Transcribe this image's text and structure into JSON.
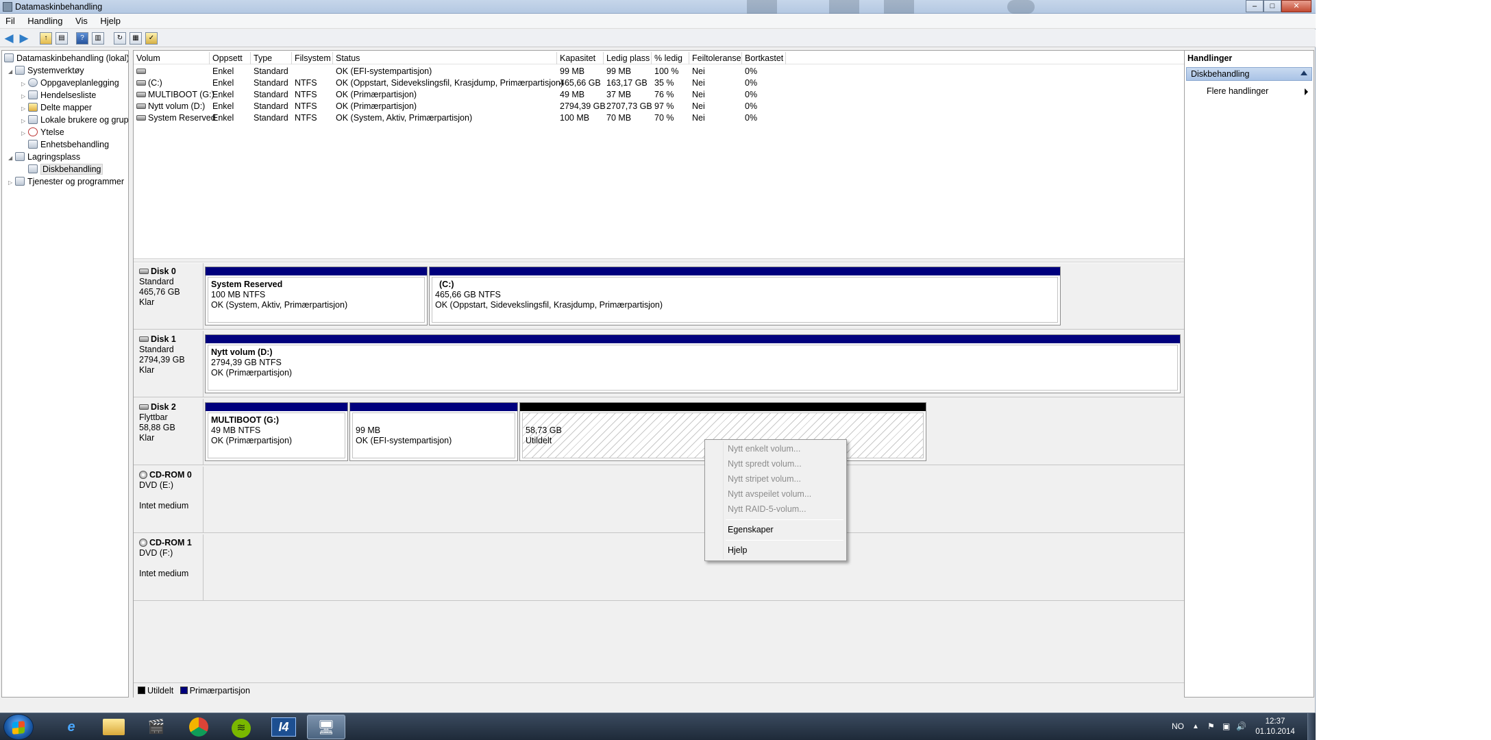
{
  "window": {
    "title": "Datamaskinbehandling",
    "min": "–",
    "max": "□",
    "close": "✕"
  },
  "menu": [
    "Fil",
    "Handling",
    "Vis",
    "Hjelp"
  ],
  "tree": {
    "root": "Datamaskinbehandling (lokal)",
    "systemverktoy": "Systemverktøy",
    "oppgave": "Oppgaveplanlegging",
    "hendelse": "Hendelsesliste",
    "delte": "Delte mapper",
    "lokale": "Lokale brukere og grupp",
    "ytelse": "Ytelse",
    "enhet": "Enhetsbehandling",
    "lagring": "Lagringsplass",
    "disk": "Diskbehandling",
    "tjenester": "Tjenester og programmer"
  },
  "volumes": {
    "columns": [
      "Volum",
      "Oppsett",
      "Type",
      "Filsystem",
      "Status",
      "Kapasitet",
      "Ledig plass",
      "% ledig",
      "Feiltoleranse",
      "Bortkastet"
    ],
    "rows": [
      {
        "volum": "",
        "oppsett": "Enkel",
        "type": "Standard",
        "fs": "",
        "status": "OK (EFI-systempartisjon)",
        "kap": "99 MB",
        "ledig": "99 MB",
        "pct": "100 %",
        "feil": "Nei",
        "bort": "0%"
      },
      {
        "volum": "(C:)",
        "oppsett": "Enkel",
        "type": "Standard",
        "fs": "NTFS",
        "status": "OK (Oppstart, Sidevekslingsfil, Krasjdump, Primærpartisjon)",
        "kap": "465,66 GB",
        "ledig": "163,17 GB",
        "pct": "35 %",
        "feil": "Nei",
        "bort": "0%"
      },
      {
        "volum": "MULTIBOOT (G:)",
        "oppsett": "Enkel",
        "type": "Standard",
        "fs": "NTFS",
        "status": "OK (Primærpartisjon)",
        "kap": "49 MB",
        "ledig": "37 MB",
        "pct": "76 %",
        "feil": "Nei",
        "bort": "0%"
      },
      {
        "volum": "Nytt volum (D:)",
        "oppsett": "Enkel",
        "type": "Standard",
        "fs": "NTFS",
        "status": "OK (Primærpartisjon)",
        "kap": "2794,39 GB",
        "ledig": "2707,73 GB",
        "pct": "97 %",
        "feil": "Nei",
        "bort": "0%"
      },
      {
        "volum": "System Reserved",
        "oppsett": "Enkel",
        "type": "Standard",
        "fs": "NTFS",
        "status": "OK (System, Aktiv, Primærpartisjon)",
        "kap": "100 MB",
        "ledig": "70 MB",
        "pct": "70 %",
        "feil": "Nei",
        "bort": "0%"
      }
    ]
  },
  "disks": {
    "d0": {
      "name": "Disk 0",
      "type": "Standard",
      "size": "465,76 GB",
      "state": "Klar",
      "p1": {
        "name": "System Reserved",
        "size": "100 MB NTFS",
        "status": "OK (System, Aktiv, Primærpartisjon)"
      },
      "p2": {
        "name": "(C:)",
        "size": "465,66 GB NTFS",
        "status": "OK (Oppstart, Sidevekslingsfil, Krasjdump, Primærpartisjon)"
      }
    },
    "d1": {
      "name": "Disk 1",
      "type": "Standard",
      "size": "2794,39 GB",
      "state": "Klar",
      "p1": {
        "name": "Nytt volum  (D:)",
        "size": "2794,39 GB NTFS",
        "status": "OK (Primærpartisjon)"
      }
    },
    "d2": {
      "name": "Disk 2",
      "type": "Flyttbar",
      "size": "58,88 GB",
      "state": "Klar",
      "p1": {
        "name": "MULTIBOOT  (G:)",
        "size": "49 MB NTFS",
        "status": "OK (Primærpartisjon)"
      },
      "p2": {
        "size": "99 MB",
        "status": "OK (EFI-systempartisjon)"
      },
      "p3": {
        "size": "58,73 GB",
        "status": "Utildelt"
      }
    },
    "cd0": {
      "name": "CD-ROM 0",
      "type": "DVD (E:)",
      "state": "Intet medium"
    },
    "cd1": {
      "name": "CD-ROM 1",
      "type": "DVD (F:)",
      "state": "Intet medium"
    }
  },
  "legend": {
    "unalloc": "Utildelt",
    "primary": "Primærpartisjon",
    "unalloc_color": "#000000",
    "primary_color": "#00007d"
  },
  "actions": {
    "header": "Handlinger",
    "section": "Diskbehandling",
    "more": "Flere handlinger"
  },
  "context_menu": {
    "items": [
      "Nytt enkelt volum...",
      "Nytt spredt volum...",
      "Nytt stripet volum...",
      "Nytt avspeilet volum...",
      "Nytt RAID-5-volum..."
    ],
    "properties": "Egenskaper",
    "help": "Hjelp"
  },
  "taskbar": {
    "lang": "NO",
    "time": "12:37",
    "date": "01.10.2014",
    "app_i4": "I4"
  },
  "icons": [
    "back-arrow-icon",
    "forward-arrow-icon",
    "up-folder-icon",
    "help-icon",
    "refresh-icon",
    "drive-icon",
    "cdrom-icon",
    "windows-start-icon"
  ]
}
